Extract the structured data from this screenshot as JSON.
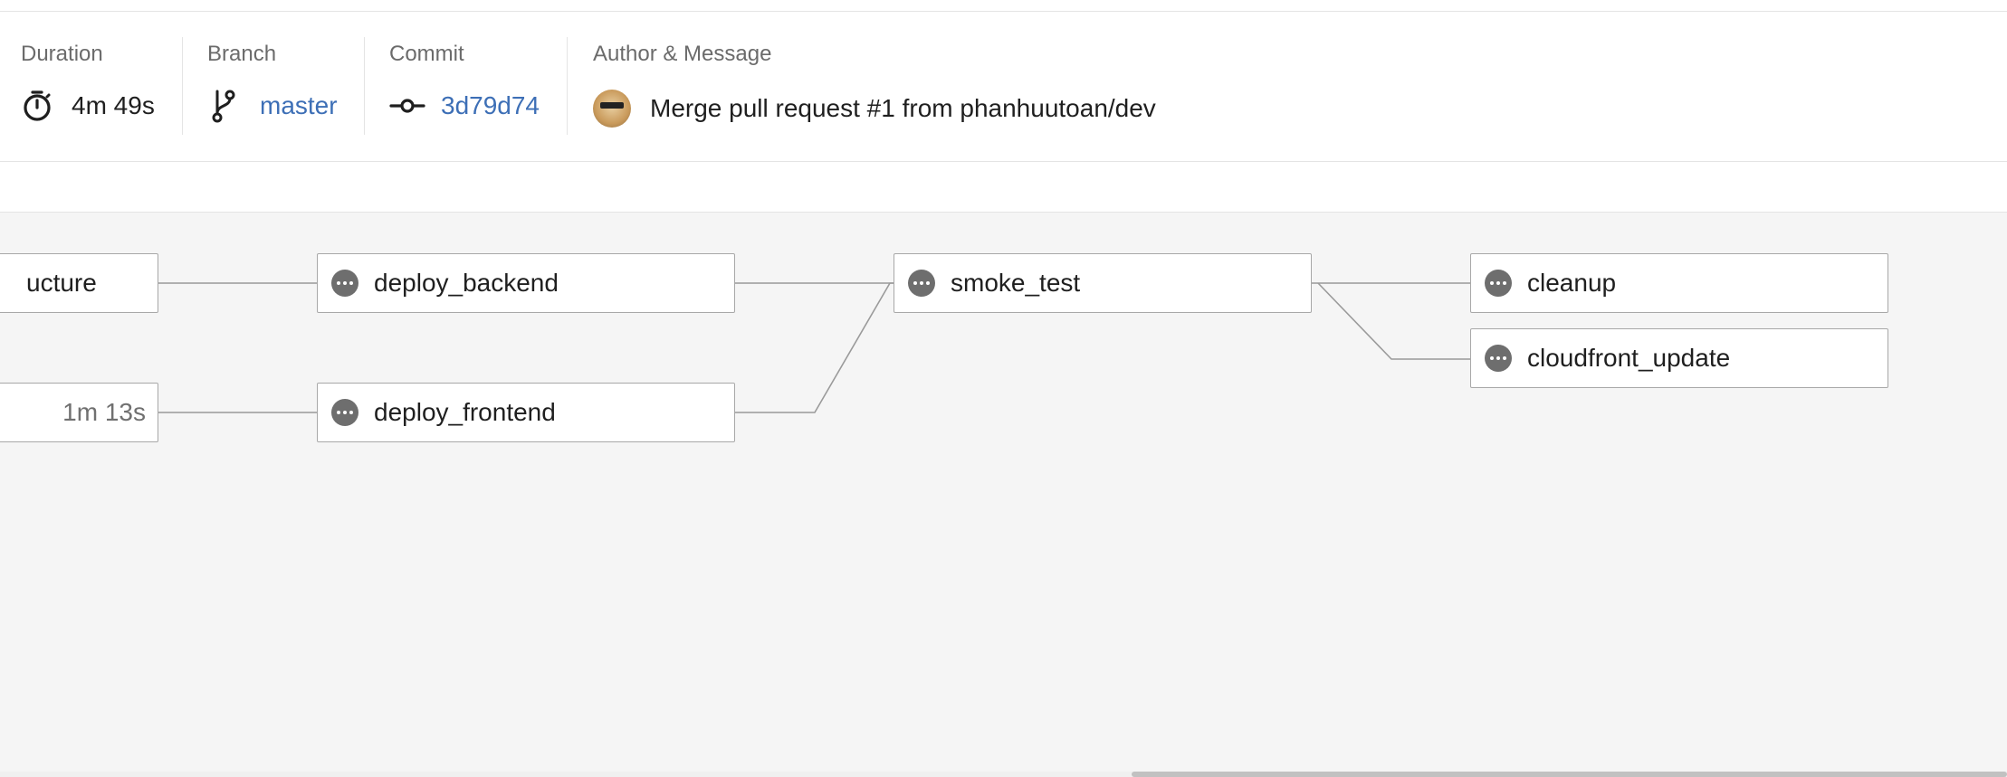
{
  "summary": {
    "duration": {
      "label": "Duration",
      "value": "4m 49s",
      "icon": "stopwatch-icon"
    },
    "branch": {
      "label": "Branch",
      "value": "master",
      "icon": "git-branch-icon"
    },
    "commit": {
      "label": "Commit",
      "value": "3d79d74",
      "icon": "git-commit-icon"
    },
    "author_message": {
      "label": "Author & Message",
      "message": "Merge pull request #1 from phanhuutoan/dev",
      "avatar": "author-avatar"
    }
  },
  "pipeline": {
    "jobs": [
      {
        "id": "infrastructure-partial",
        "label": "ucture",
        "status": "pending",
        "duration": ""
      },
      {
        "id": "upstream-partial",
        "label": "",
        "status": "pending",
        "duration": "1m 13s"
      },
      {
        "id": "deploy_backend",
        "label": "deploy_backend",
        "status": "pending",
        "duration": ""
      },
      {
        "id": "deploy_frontend",
        "label": "deploy_frontend",
        "status": "pending",
        "duration": ""
      },
      {
        "id": "smoke_test",
        "label": "smoke_test",
        "status": "pending",
        "duration": ""
      },
      {
        "id": "cleanup",
        "label": "cleanup",
        "status": "pending",
        "duration": ""
      },
      {
        "id": "cloudfront_update",
        "label": "cloudfront_update",
        "status": "pending",
        "duration": ""
      }
    ]
  },
  "colors": {
    "link": "#3d6fb6",
    "status_pending": "#6e6e6e",
    "canvas_bg": "#f5f5f5",
    "edge": "#9a9a9a"
  }
}
